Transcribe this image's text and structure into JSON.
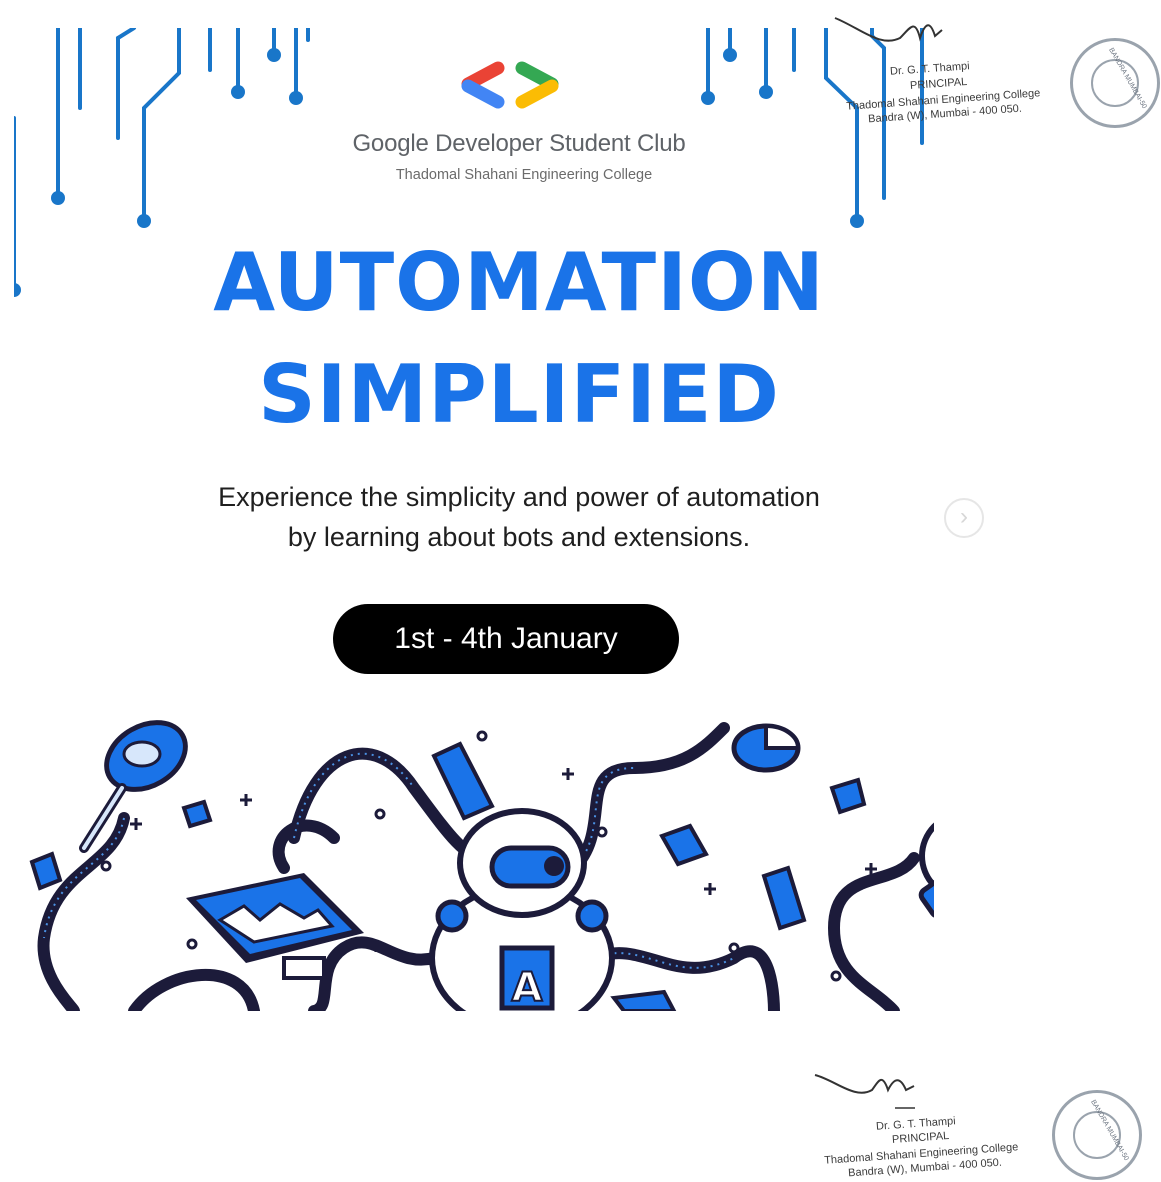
{
  "poster": {
    "club_name": "Google Developer Student Club",
    "college_name": "Thadomal Shahani Engineering College",
    "headline_line1": "AUTOMATION",
    "headline_line2": "SIMPLIFIED",
    "description_line1": "Experience the simplicity and power of automation",
    "description_line2": "by learning about bots and extensions.",
    "date": "1st - 4th January",
    "robot_badge": "A"
  },
  "carousel": {
    "next_icon": "chevron-right-icon",
    "next_glyph": "›"
  },
  "signature_top": {
    "name": "Dr. G. T. Thampi",
    "title": "PRINCIPAL",
    "college": "Thadomal Shahani Engineering College",
    "address": "Bandra (W), Mumbai - 400 050."
  },
  "signature_bottom": {
    "name": "Dr. G. T. Thampi",
    "title": "PRINCIPAL",
    "college": "Thadomal Shahani Engineering College",
    "address": "Bandra (W), Mumbai - 400 050."
  },
  "seal": {
    "ring_text": "THADOMAL SHAHANI ENGINEERING COLLEGE",
    "center_text": "BANDRA MUMBAI-50"
  },
  "colors": {
    "brand_blue": "#1a73e8",
    "circuit_blue": "#1976c9",
    "google_red": "#ea4335",
    "google_blue": "#4285f4",
    "google_green": "#34a853",
    "google_yellow": "#fbbc04",
    "ink": "#1c1b3a"
  }
}
